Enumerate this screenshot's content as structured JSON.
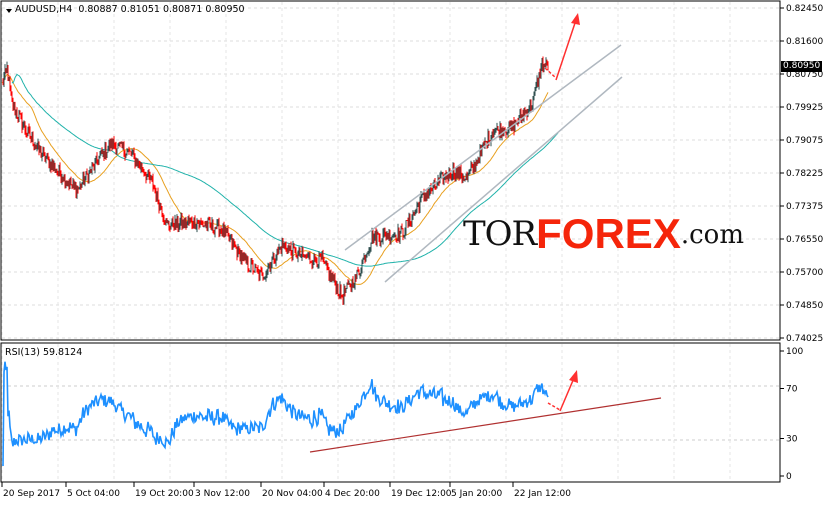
{
  "header": {
    "symbol": "AUDUSD,H4",
    "open": "0.80887",
    "high": "0.81051",
    "low": "0.80871",
    "close": "0.80950"
  },
  "rsi": {
    "label": "RSI(13) 59.8124",
    "levels": [
      "100",
      "70",
      "30",
      "0"
    ]
  },
  "price_axis": [
    "0.82450",
    "0.81600",
    "0.80750",
    "0.79925",
    "0.79075",
    "0.78225",
    "0.77375",
    "0.76550",
    "0.75700",
    "0.74850",
    "0.74025"
  ],
  "current_price": "0.80950",
  "time_axis": [
    "20 Sep 2017",
    "5 Oct 04:00",
    "19 Oct 20:00",
    "3 Nov 12:00",
    "20 Nov 04:00",
    "4 Dec 20:00",
    "19 Dec 12:00",
    "5 Jan 20:00",
    "22 Jan 12:00"
  ],
  "logo": {
    "tor": "TOR",
    "forex": "FOREX",
    "com": ".com"
  },
  "colors": {
    "bull": "#2f4f4f",
    "bear": "#ff0000",
    "ma_fast": "#e8a020",
    "ma_slow": "#20b2aa",
    "rsi": "#1e90ff",
    "trend": "#b03030",
    "channel": "#b0b8c0",
    "arrow": "#ff3030"
  },
  "chart_data": {
    "type": "candlestick",
    "symbol": "AUDUSD",
    "timeframe": "H4",
    "ylim": [
      0.74025,
      0.8245
    ],
    "close_path": [
      [
        0,
        0.805
      ],
      [
        5,
        0.809
      ],
      [
        10,
        0.8
      ],
      [
        20,
        0.795
      ],
      [
        40,
        0.787
      ],
      [
        75,
        0.778
      ],
      [
        100,
        0.787
      ],
      [
        110,
        0.79
      ],
      [
        130,
        0.787
      ],
      [
        150,
        0.78
      ],
      [
        165,
        0.769
      ],
      [
        190,
        0.77
      ],
      [
        220,
        0.768
      ],
      [
        245,
        0.759
      ],
      [
        260,
        0.756
      ],
      [
        280,
        0.764
      ],
      [
        300,
        0.761
      ],
      [
        320,
        0.76
      ],
      [
        340,
        0.751
      ],
      [
        355,
        0.756
      ],
      [
        370,
        0.766
      ],
      [
        400,
        0.767
      ],
      [
        420,
        0.776
      ],
      [
        450,
        0.783
      ],
      [
        465,
        0.781
      ],
      [
        490,
        0.793
      ],
      [
        510,
        0.794
      ],
      [
        530,
        0.8
      ],
      [
        540,
        0.81
      ],
      [
        546,
        0.8095
      ]
    ],
    "rsi_ylim": [
      0,
      100
    ]
  }
}
